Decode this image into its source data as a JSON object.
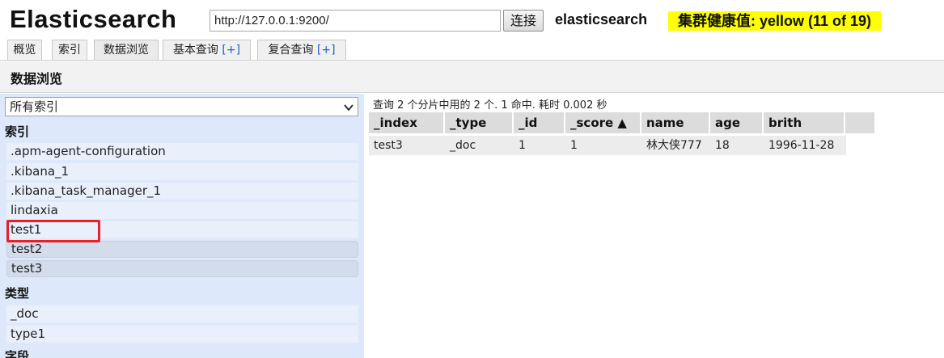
{
  "header": {
    "app_title": "Elasticsearch",
    "url_value": "http://127.0.0.1:9200/",
    "connect_label": "连接",
    "cluster_name": "elasticsearch",
    "health": "集群健康值: yellow (11 of 19)",
    "health_color": "#ffff00"
  },
  "tabs": [
    {
      "label": "概览",
      "plus": ""
    },
    {
      "label": "索引",
      "plus": ""
    },
    {
      "label": "数据浏览",
      "plus": ""
    },
    {
      "label": "基本查询 ",
      "plus": "[+]"
    },
    {
      "label": "复合查询 ",
      "plus": "[+]"
    }
  ],
  "active_tab": "数据浏览",
  "page_title": "数据浏览",
  "sidebar": {
    "index_select": "所有索引",
    "indices_heading": "索引",
    "indices": [
      ".apm-agent-configuration",
      ".kibana_1",
      ".kibana_task_manager_1",
      "lindaxia",
      "test1",
      "test2",
      "test3"
    ],
    "selected_indices": [
      "test2",
      "test3"
    ],
    "highlighted_index": "test1",
    "types_heading": "类型",
    "types": [
      "_doc",
      "type1"
    ],
    "fields_heading": "字段"
  },
  "results": {
    "summary": "查询 2 个分片中用的 2 个. 1 命中. 耗时 0.002 秒",
    "columns": [
      "_index",
      "_type",
      "_id",
      "_score ▲",
      "name",
      "age",
      "brith"
    ],
    "rows": [
      [
        "test3",
        "_doc",
        "1",
        "1",
        "林大侠777",
        "18",
        "1996-11-28"
      ]
    ]
  },
  "colors": {
    "sidebar_bg": "#dde8fb",
    "highlight_box": "#e8202a",
    "link_blue": "#1d5fd6"
  }
}
